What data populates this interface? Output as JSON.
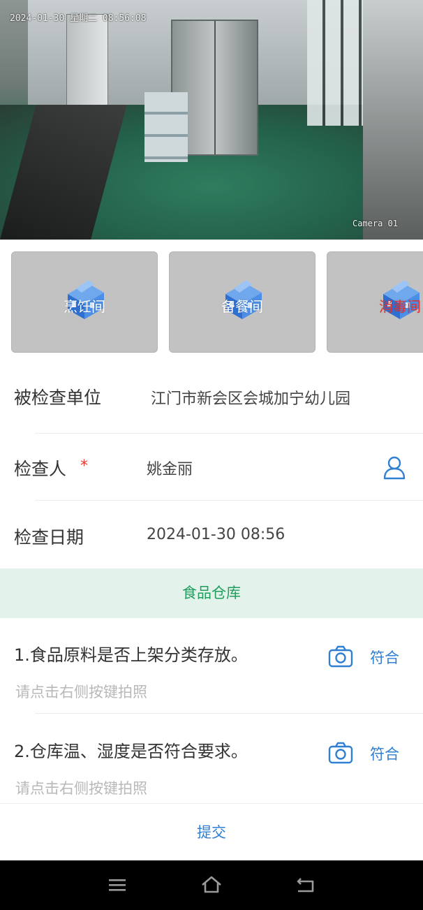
{
  "camera": {
    "timestamp": "2024-01-30 星期二 08:56:08",
    "camera_name": "Camera 01"
  },
  "rooms": [
    {
      "label": "烹饪间",
      "selected": false,
      "icon": "building-icon"
    },
    {
      "label": "备餐间",
      "selected": false,
      "icon": "building-icon"
    },
    {
      "label": "消毒间",
      "selected": true,
      "icon": "building-icon"
    }
  ],
  "form": {
    "unit_label": "被检查单位",
    "unit_value": "江门市新会区会城加宁幼儿园",
    "inspector_label": "检查人",
    "required_mark": "*",
    "inspector_value": "姚金丽",
    "date_label": "检查日期",
    "date_value": "2024-01-30 08:56"
  },
  "section": {
    "title": "食品仓库"
  },
  "items": [
    {
      "question": "1.食品原料是否上架分类存放。",
      "hint": "请点击右侧按键拍照",
      "status": "符合"
    },
    {
      "question": "2.仓库温、湿度是否符合要求。",
      "hint": "请点击右侧按键拍照",
      "status": "符合"
    }
  ],
  "submit": {
    "label": "提交"
  },
  "colors": {
    "accent_blue": "#2f7fd2",
    "section_green": "#1f9d5c",
    "section_bg": "#e3f3ec",
    "required_red": "#e53a32"
  }
}
